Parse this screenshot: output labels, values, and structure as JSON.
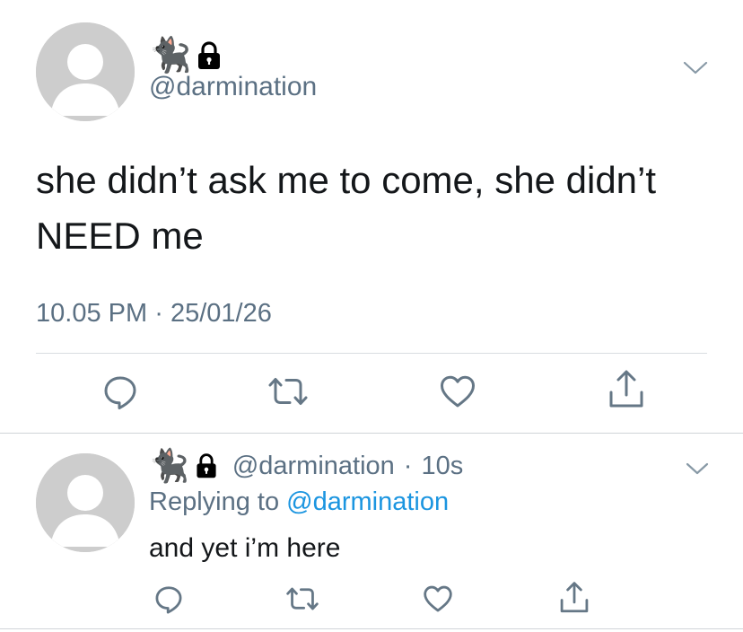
{
  "tweet": {
    "author_emoji": "🐈‍⬛",
    "handle": "@darmination",
    "text": "she didn’t ask me to come, she didn’t NEED me",
    "time": "10.05 PM",
    "separator": "·",
    "date": "25/01/26",
    "icons": {
      "avatar": "default-avatar-icon",
      "lock": "lock-icon",
      "menu": "chevron-down-icon",
      "reply": "reply-icon",
      "retweet": "retweet-icon",
      "like": "heart-icon",
      "share": "share-icon"
    }
  },
  "reply": {
    "author_emoji": "🐈‍⬛",
    "handle": "@darmination",
    "separator": "·",
    "time": "10s",
    "replying_prefix": "Replying to",
    "replying_handle": "@darmination",
    "text": "and yet i’m here"
  },
  "colors": {
    "text": "#14171a",
    "secondary": "#5b7083",
    "link": "#1b95e0",
    "avatar": "#cdcdcd",
    "divider": "#d9dde1"
  }
}
